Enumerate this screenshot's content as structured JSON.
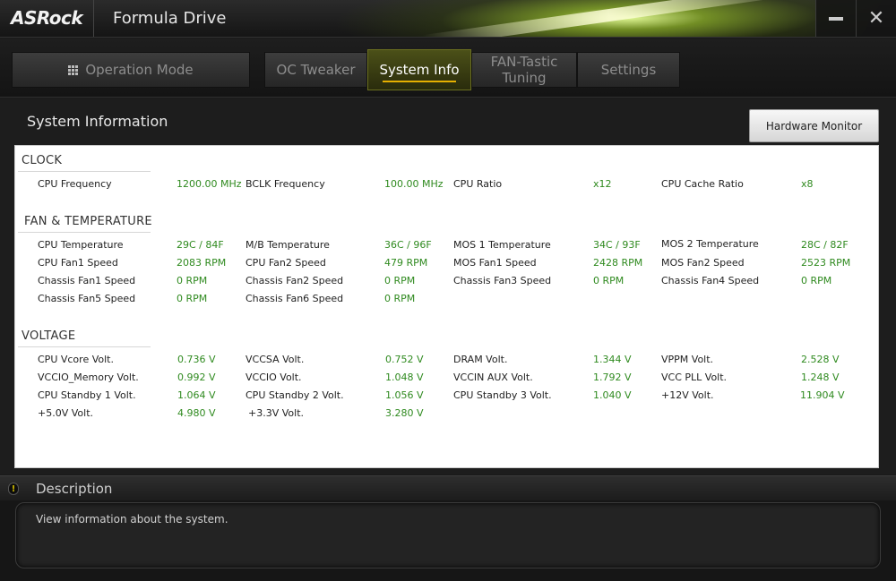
{
  "window": {
    "brand": "ASRock",
    "title": "Formula Drive",
    "minimize_icon": "minimize-icon",
    "close_icon": "close-icon"
  },
  "nav": {
    "operation_mode": "Operation Mode",
    "oc_tweaker": "OC Tweaker",
    "system_info": "System Info",
    "fan_tuning": "FAN-Tastic Tuning",
    "settings": "Settings",
    "active": "System Info"
  },
  "main": {
    "section_title": "System Information",
    "hardware_monitor_label": "Hardware Monitor"
  },
  "clock": {
    "title": "CLOCK",
    "items": [
      {
        "label": "CPU Frequency",
        "value": "1200.00 MHz"
      },
      {
        "label": "BCLK Frequency",
        "value": "100.00 MHz"
      },
      {
        "label": "CPU Ratio",
        "value": "x12"
      },
      {
        "label": "CPU Cache Ratio",
        "value": "x8"
      }
    ]
  },
  "fan_temp": {
    "title": "FAN & TEMPERATURE",
    "items": [
      {
        "label": "CPU Temperature",
        "value": "29C / 84F"
      },
      {
        "label": "M/B Temperature",
        "value": "36C / 96F"
      },
      {
        "label": "MOS 1 Temperature",
        "value": "34C / 93F"
      },
      {
        "label": "MOS 2 Temperature",
        "value": "28C / 82F"
      },
      {
        "label": "CPU Fan1 Speed",
        "value": "2083 RPM"
      },
      {
        "label": "CPU Fan2 Speed",
        "value": "479 RPM"
      },
      {
        "label": "MOS Fan1 Speed",
        "value": "2428 RPM"
      },
      {
        "label": "MOS Fan2 Speed",
        "value": "2523 RPM"
      },
      {
        "label": "Chassis Fan1 Speed",
        "value": "0 RPM"
      },
      {
        "label": "Chassis Fan2 Speed",
        "value": "0 RPM"
      },
      {
        "label": "Chassis Fan3 Speed",
        "value": "0 RPM"
      },
      {
        "label": "Chassis Fan4 Speed",
        "value": "0 RPM"
      },
      {
        "label": "Chassis Fan5 Speed",
        "value": "0 RPM"
      },
      {
        "label": "Chassis Fan6 Speed",
        "value": "0 RPM"
      }
    ]
  },
  "voltage": {
    "title": "VOLTAGE",
    "items": [
      {
        "label": "CPU Vcore Volt.",
        "value": "0.736 V"
      },
      {
        "label": "VCCSA Volt.",
        "value": "0.752 V"
      },
      {
        "label": "DRAM Volt.",
        "value": "1.344 V"
      },
      {
        "label": "VPPM Volt.",
        "value": "2.528 V"
      },
      {
        "label": "VCCIO_Memory Volt.",
        "value": "0.992 V"
      },
      {
        "label": "VCCIO Volt.",
        "value": "1.048 V"
      },
      {
        "label": "VCCIN AUX Volt.",
        "value": "1.792 V"
      },
      {
        "label": "VCC PLL Volt.",
        "value": "1.248 V"
      },
      {
        "label": "CPU Standby 1 Volt.",
        "value": "1.064 V"
      },
      {
        "label": "CPU Standby 2 Volt.",
        "value": "1.056 V"
      },
      {
        "label": "CPU Standby 3 Volt.",
        "value": "1.040 V"
      },
      {
        "label": "+12V Volt.",
        "value": "11.904 V"
      },
      {
        "label": "+5.0V Volt.",
        "value": "4.980 V"
      },
      {
        "label": "+3.3V Volt.",
        "value": "3.280 V"
      }
    ]
  },
  "description": {
    "title": "Description",
    "icon": "info-icon",
    "text": "View information about the system."
  },
  "colors": {
    "value_green": "#2f8a1f",
    "active_tab": "#4b5018",
    "active_underline": "#e6b000"
  }
}
